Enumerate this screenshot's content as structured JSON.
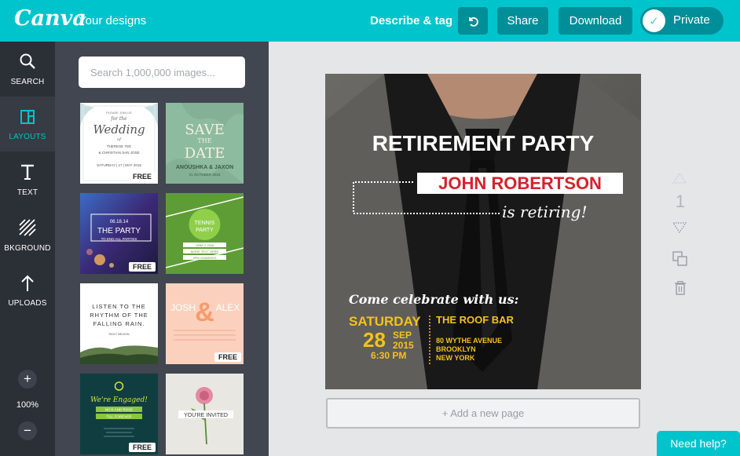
{
  "header": {
    "logo": "Canva",
    "your_designs": "Your designs",
    "describe_tag": "Describe & tag",
    "share": "Share",
    "download": "Download",
    "private": "Private"
  },
  "nav": {
    "search": "SEARCH",
    "layouts": "LAYOUTS",
    "text": "TEXT",
    "background": "BKGROUND",
    "uploads": "UPLOADS",
    "zoom_in": "+",
    "zoom_level": "100%",
    "zoom_out": "−"
  },
  "panel": {
    "search_placeholder": "Search 1,000,000 images...",
    "badge_free": "FREE"
  },
  "thumbnails": {
    "wedding": {
      "line1": "PLEASE JOIN US",
      "line2": "for the",
      "line3": "Wedding",
      "line4": "of",
      "line5": "THERESE TEE",
      "line6": "& CHRISTIAN SAN JOSE",
      "line7": "SATURDAY | 17 | MAY 2015"
    },
    "save_date": {
      "line1": "SAVE",
      "line2": "THE",
      "line3": "DATE",
      "line4": "ANOUSHKA & JAXON",
      "line5": "21 OCTOBER 2015"
    },
    "party": {
      "date": "06.18.14",
      "title": "THE PARTY",
      "sub": "TO END ALL PARTIES"
    },
    "tennis": {
      "title": "TENNIS",
      "sub": "PARTY",
      "d1": "JUNE 2 2016",
      "d2": "MORE TEXT HERE",
      "d3": "2PM ONWARDS"
    },
    "rain": {
      "l1": "LISTEN TO THE",
      "l2": "RHYTHM OF THE",
      "l3": "FALLING RAIN.",
      "l4": "RICKY NELSON"
    },
    "josh": {
      "n1": "JOSH",
      "amp": "&",
      "n2": "ALEX"
    },
    "engaged": {
      "title": "We're Engaged!",
      "r1": "NICK AND ROSE",
      "r2": "TILL FOREVER"
    },
    "invited": {
      "title": "YOU'RE INVITED"
    }
  },
  "canvas": {
    "title": "RETIREMENT PARTY",
    "name": "JOHN ROBERTSON",
    "retiring": "is retiring!",
    "come": "Come celebrate with us:",
    "day": "SATURDAY",
    "date_num": "28",
    "month": "SEP",
    "year": "2015",
    "time": "6:30 PM",
    "venue": "THE ROOF BAR",
    "addr1": "80 WYTHE AVENUE",
    "addr2": "BROOKLYN",
    "addr3": "NEW YORK"
  },
  "page_number": "1",
  "add_page": "+ Add a new page",
  "help": "Need help?"
}
